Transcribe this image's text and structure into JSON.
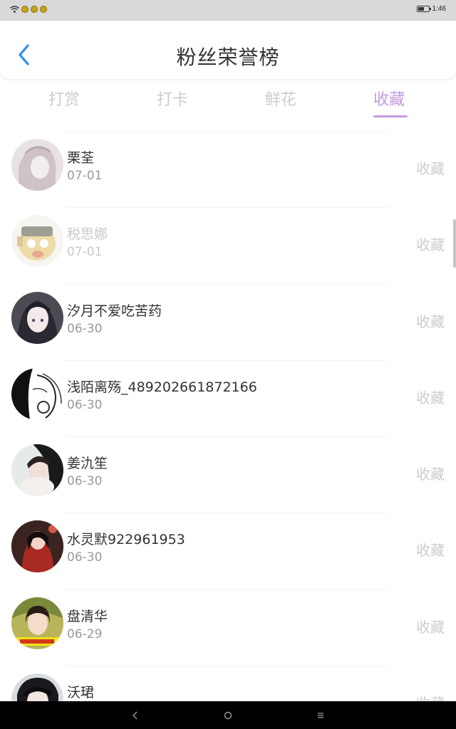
{
  "status_bar": {
    "time": "1:46",
    "battery_level": 0.6,
    "icons": [
      "wifi-icon",
      "notification-icon",
      "notification-icon",
      "notification-icon"
    ]
  },
  "header": {
    "title": "粉丝荣誉榜",
    "back_icon": "chevron-left-icon"
  },
  "tabs": [
    {
      "label": "打赏",
      "active": false
    },
    {
      "label": "打卡",
      "active": false
    },
    {
      "label": "鲜花",
      "active": false
    },
    {
      "label": "收藏",
      "active": true
    }
  ],
  "fans": [
    {
      "name": "栗荃",
      "date": "07-01",
      "action": "收藏"
    },
    {
      "name": "税思娜",
      "date": "07-01",
      "action": "收藏"
    },
    {
      "name": "汐月不爱吃苦药",
      "date": "06-30",
      "action": "收藏"
    },
    {
      "name": "浅陌离殇_489202661872166",
      "date": "06-30",
      "action": "收藏"
    },
    {
      "name": "姜氿笙",
      "date": "06-30",
      "action": "收藏"
    },
    {
      "name": "水灵默922961953",
      "date": "06-30",
      "action": "收藏"
    },
    {
      "name": "盘清华",
      "date": "06-29",
      "action": "收藏"
    },
    {
      "name": "沃珺",
      "date": "",
      "action": "收藏"
    }
  ],
  "nav_bar": {
    "icons": [
      "back-nav-icon",
      "home-nav-icon",
      "recents-nav-icon"
    ]
  },
  "colors": {
    "accent": "#c39be2",
    "inactive_tab": "#cccccc",
    "text_primary": "#333333",
    "text_secondary": "#999999",
    "back_arrow": "#2b8ef0",
    "status_bar_bg": "#d9d9d9",
    "nav_bar_bg": "#000000"
  }
}
